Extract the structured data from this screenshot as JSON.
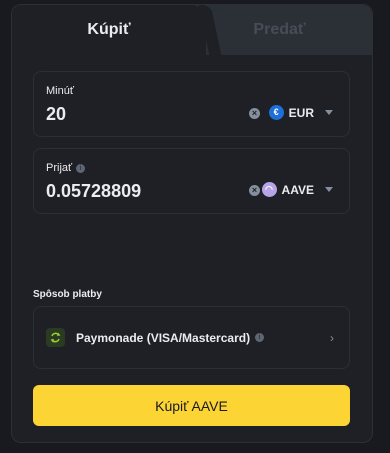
{
  "tabs": {
    "buy_label": "Kúpiť",
    "sell_label": "Predať"
  },
  "spend": {
    "label": "Minúť",
    "value": "20",
    "currency": "EUR",
    "coin_glyph": "€"
  },
  "receive": {
    "label": "Prijať",
    "value": "0.05728809",
    "currency": "AAVE",
    "coin_glyph": "◠"
  },
  "payment": {
    "section_label": "Spôsob platby",
    "method_name": "Paymonade (VISA/Mastercard)"
  },
  "action": {
    "buy_label": "Kúpiť AAVE"
  },
  "colors": {
    "accent": "#fcd535",
    "eur_coin": "#1e6fd9",
    "aave_coin": "#b6a2e6",
    "pay_icon": "#9bd12a"
  }
}
